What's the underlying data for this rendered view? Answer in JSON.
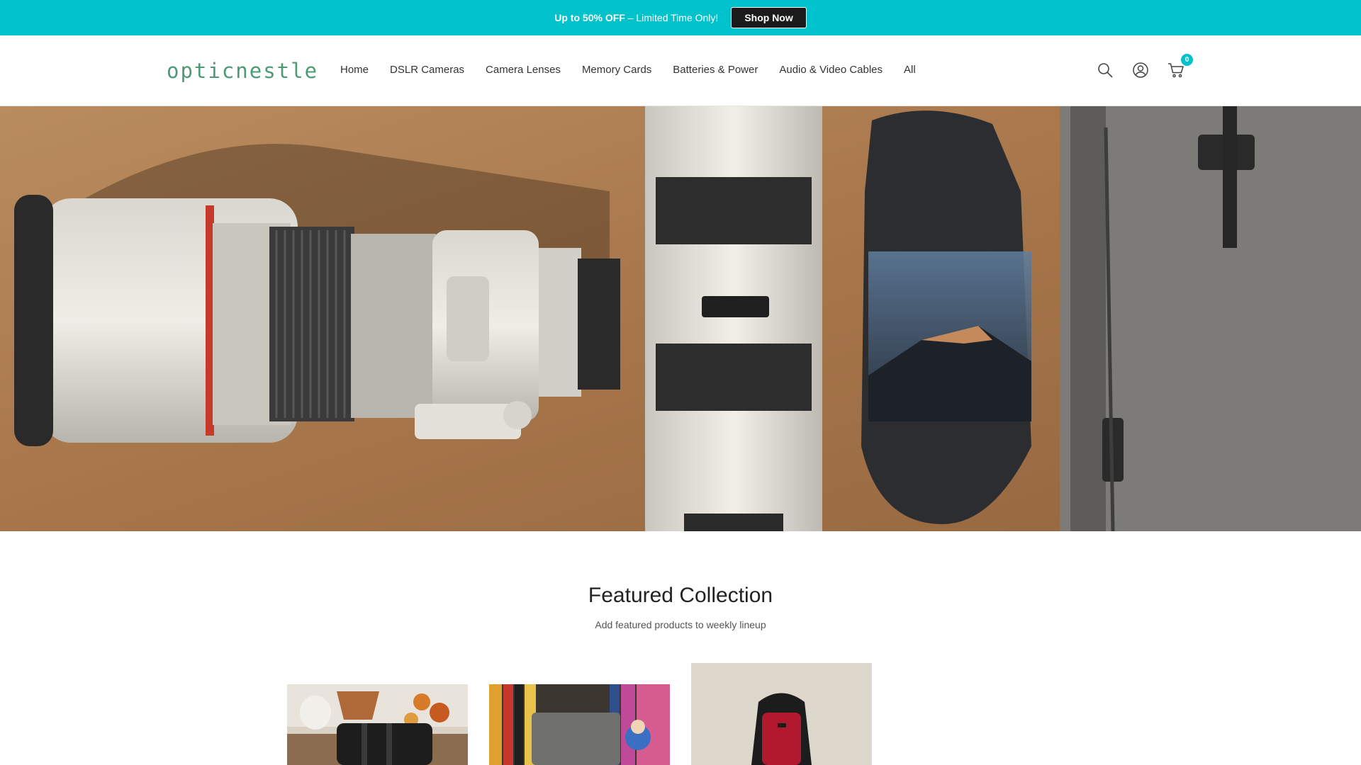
{
  "announcement": {
    "highlight": "Up to 50% OFF",
    "text": " – Limited Time Only!",
    "button_label": "Shop Now",
    "background_color": "#00c2cb"
  },
  "header": {
    "logo": "opticnestle",
    "nav": [
      {
        "label": "Home"
      },
      {
        "label": "DSLR Cameras"
      },
      {
        "label": "Camera Lenses"
      },
      {
        "label": "Memory Cards"
      },
      {
        "label": "Batteries & Power"
      },
      {
        "label": "Audio & Video Cables"
      },
      {
        "label": "All"
      }
    ],
    "icons": [
      "search-icon",
      "account-icon",
      "cart-icon"
    ],
    "cart_count": "0"
  },
  "hero": {
    "image": "camera-lenses-and-bags-on-sand"
  },
  "featured": {
    "title": "Featured Collection",
    "subtitle": "Add featured products to weekly lineup",
    "products": [
      {
        "image": "zoom-lens-on-table"
      },
      {
        "image": "camera-on-bookshelf"
      },
      {
        "image": "red-black-backpack-on-carpet"
      }
    ]
  }
}
